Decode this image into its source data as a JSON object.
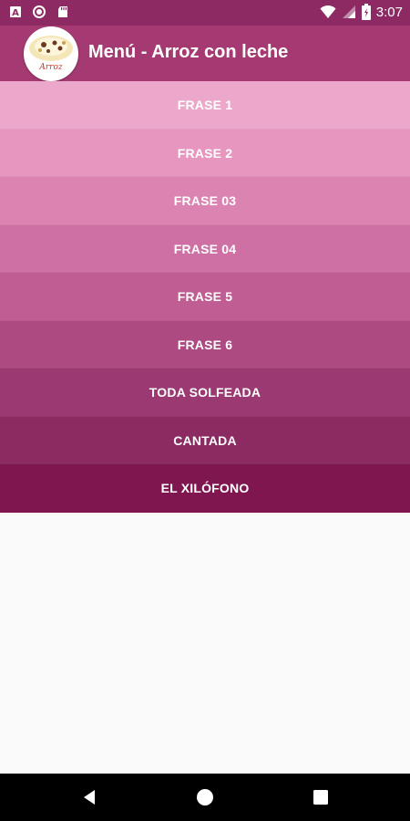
{
  "status_bar": {
    "time": "3:07",
    "left_icons": [
      "text-a-icon",
      "record-icon",
      "sd-card-icon"
    ],
    "right_icons": [
      "wifi-icon",
      "signal-icon",
      "battery-icon"
    ]
  },
  "app_bar": {
    "title": "Menú - Arroz con leche",
    "avatar_text": "Arroz"
  },
  "menu": {
    "items": [
      {
        "label": "FRASE 1",
        "color": "#eca8ca"
      },
      {
        "label": "FRASE 2",
        "color": "#e696bf"
      },
      {
        "label": "FRASE 03",
        "color": "#db84b1"
      },
      {
        "label": "FRASE 04",
        "color": "#cf70a4"
      },
      {
        "label": "FRASE 5",
        "color": "#c05e94"
      },
      {
        "label": "FRASE 6",
        "color": "#ad4a82"
      },
      {
        "label": "TODA SOLFEADA",
        "color": "#9b3a72"
      },
      {
        "label": "CANTADA",
        "color": "#8c2a62"
      },
      {
        "label": "EL XILÓFONO",
        "color": "#801650"
      }
    ]
  },
  "colors": {
    "status_bar": "#8d2a63",
    "app_bar": "#a53a72",
    "background": "#fafafa",
    "nav_bar": "#000000"
  }
}
